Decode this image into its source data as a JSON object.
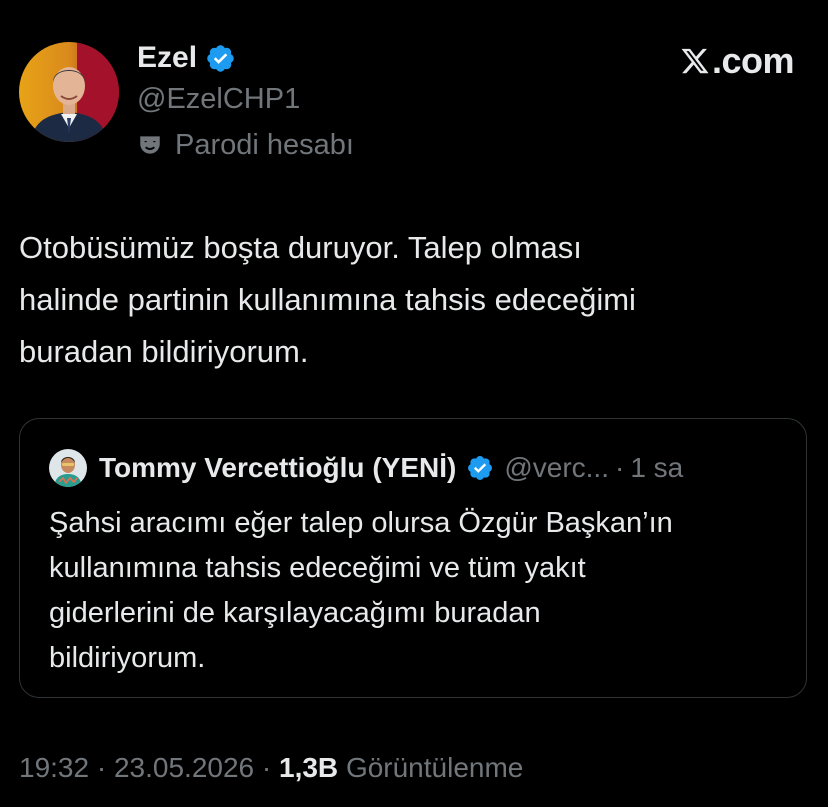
{
  "author": {
    "display_name": "Ezel",
    "handle": "@EzelCHP1",
    "label_icon": "theater-mask-icon",
    "label": "Parodi hesabı",
    "verified_color": "#1d9bf0"
  },
  "brand": {
    "text": ".com",
    "icon": "x-logo-icon"
  },
  "tweet": {
    "lines": [
      "Otobüsümüz boşta duruyor. Talep olması",
      "halinde partinin kullanımına tahsis edeceğimi",
      "buradan bildiriyorum."
    ]
  },
  "quote": {
    "display_name": "Tommy Vercettioğlu (YENİ)",
    "handle": "@verc...",
    "separator": "·",
    "time": "1 sa",
    "lines": [
      "Şahsi aracımı eğer talep olursa Özgür Başkan’ın",
      "kullanımına tahsis edeceğimi ve tüm yakıt",
      "giderlerini de karşılayacağımı buradan",
      "bildiriyorum."
    ]
  },
  "meta": {
    "time": "19:32",
    "separator": "·",
    "date": "23.05.2026",
    "views_count": "1,3B",
    "views_label": "Görüntülenme"
  },
  "colors": {
    "background": "#000000",
    "text_primary": "#e7e9ea",
    "text_secondary": "#71767b",
    "border": "#2f3336",
    "verified": "#1d9bf0"
  }
}
